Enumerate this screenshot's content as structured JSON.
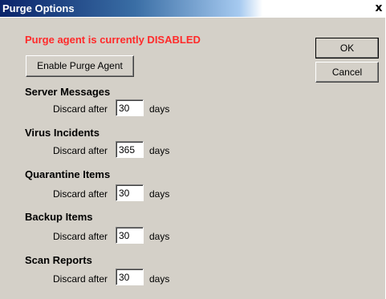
{
  "window": {
    "title": "Purge Options",
    "close_glyph": "x"
  },
  "status": {
    "text": "Purge agent is currently DISABLED",
    "color": "#ff2a2a"
  },
  "buttons": {
    "enable_label": "Enable Purge Agent",
    "ok_label": "OK",
    "cancel_label": "Cancel"
  },
  "sections": [
    {
      "title": "Server Messages",
      "discard_label": "Discard after",
      "value": "30",
      "unit": "days"
    },
    {
      "title": "Virus Incidents",
      "discard_label": "Discard after",
      "value": "365",
      "unit": "days"
    },
    {
      "title": "Quarantine Items",
      "discard_label": "Discard after",
      "value": "30",
      "unit": "days"
    },
    {
      "title": "Backup Items",
      "discard_label": "Discard after",
      "value": "30",
      "unit": "days"
    },
    {
      "title": "Scan Reports",
      "discard_label": "Discard after",
      "value": "30",
      "unit": "days"
    }
  ],
  "colors": {
    "titlebar_start": "#0a246a",
    "dialog_background": "#d4d0c8"
  }
}
